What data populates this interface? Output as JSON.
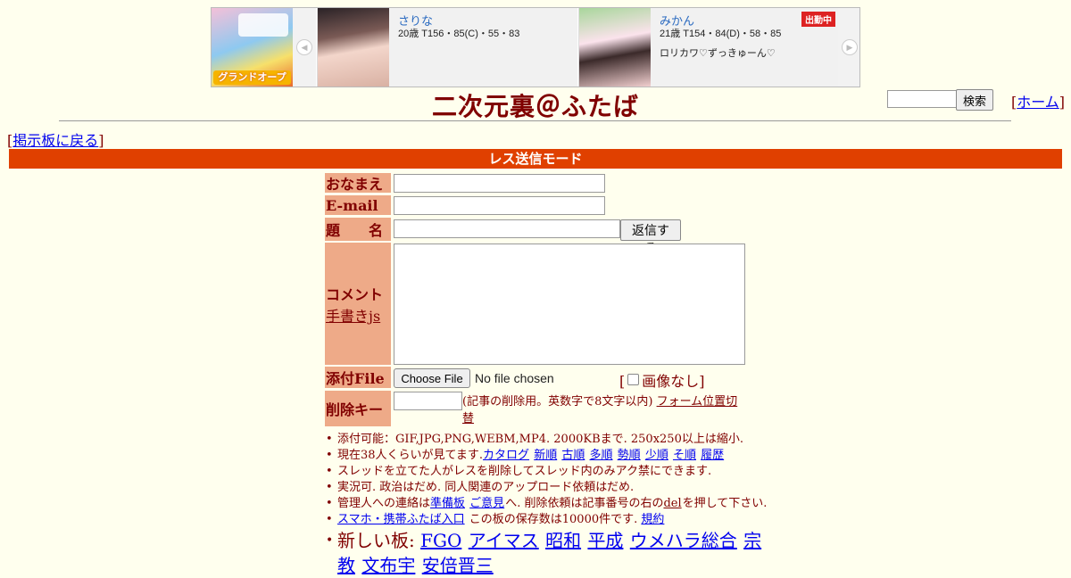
{
  "ad": {
    "shop": {
      "badge": "グランドオープン"
    },
    "cards": [
      {
        "name": "さりな",
        "spec": "20歳 T156・85(C)・55・83",
        "message": "",
        "status": ""
      },
      {
        "name": "みかん",
        "spec": "21歳 T154・84(D)・58・85",
        "message": "ロリカワ♡ずっきゅーん♡",
        "status": "出勤中"
      }
    ]
  },
  "header": {
    "title": "二次元裏＠ふたば",
    "search_button": "検索",
    "home_link": "ホーム",
    "back_link": "掲示板に戻る"
  },
  "mode_bar": "レス送信モード",
  "form": {
    "name_label": "おなまえ",
    "email_label": "E-mail",
    "subject_label": "題　　名",
    "reply_button": "返信する",
    "comment_label": "コメント",
    "handwrite_link": "手書きjs",
    "file_label": "添付File",
    "file_button": "Choose File",
    "file_status": "No file chosen",
    "no_image": "画像なし",
    "delkey_label": "削除キー",
    "delkey_note": "(記事の削除用。英数字で8文字以内)",
    "form_position_link": "フォーム位置切替"
  },
  "notes": {
    "n1": "添付可能：GIF,JPG,PNG,WEBM,MP4. 2000KBまで. 250x250以上は縮小.",
    "n2_prefix": "現在38人くらいが見てます.",
    "n2_links": [
      "カタログ",
      "新順",
      "古順",
      "多順",
      "勢順",
      "少順",
      "そ順",
      "履歴"
    ],
    "n3": "スレッドを立てた人がレスを削除してスレッド内のみアク禁にできます.",
    "n4": "実況可. 政治はだめ. 同人関連のアップロード依頼はだめ.",
    "n5_prefix": "管理人への連絡は",
    "n5_link1": "準備板",
    "n5_link2": "ご意見",
    "n5_middle": "へ. 削除依頼は記事番号の右の",
    "n5_del": "del",
    "n5_suffix": "を押して下さい.",
    "n6_link": "スマホ・携帯ふたば入口",
    "n6_text": " この板の保存数は10000件です.",
    "n6_terms": "規約",
    "new_boards_label": "新しい板:",
    "new_boards": [
      "FGO",
      "アイマス",
      "昭和",
      "平成",
      "ウメハラ総合",
      "宗教",
      "文布宇",
      "安倍晋三"
    ]
  }
}
